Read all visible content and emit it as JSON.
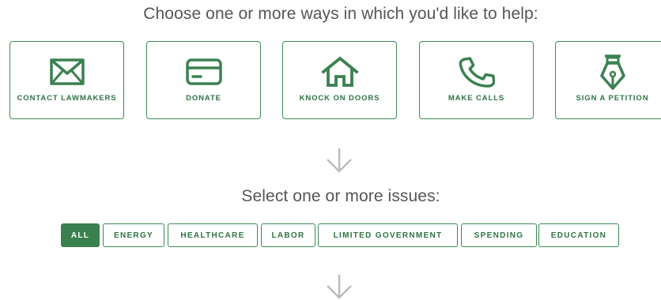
{
  "help": {
    "heading": "Choose one or more ways in which you'd like to help:",
    "options": [
      {
        "label": "CONTACT LAWMAKERS",
        "icon": "envelope-icon"
      },
      {
        "label": "DONATE",
        "icon": "credit-card-icon"
      },
      {
        "label": "KNOCK ON DOORS",
        "icon": "house-icon"
      },
      {
        "label": "MAKE CALLS",
        "icon": "phone-icon"
      },
      {
        "label": "SIGN A PETITION",
        "icon": "pen-nib-icon"
      }
    ]
  },
  "issues": {
    "heading": "Select one or more issues:",
    "items": [
      {
        "label": "ALL",
        "selected": true
      },
      {
        "label": "ENERGY",
        "selected": false
      },
      {
        "label": "HEALTHCARE",
        "selected": false
      },
      {
        "label": "LABOR",
        "selected": false
      },
      {
        "label": "LIMITED GOVERNMENT",
        "selected": false
      },
      {
        "label": "SPENDING",
        "selected": false
      },
      {
        "label": "EDUCATION",
        "selected": false
      }
    ]
  },
  "colors": {
    "brand_green": "#3b8150",
    "text_gray": "#555555",
    "arrow_gray": "#bcbcbc"
  }
}
